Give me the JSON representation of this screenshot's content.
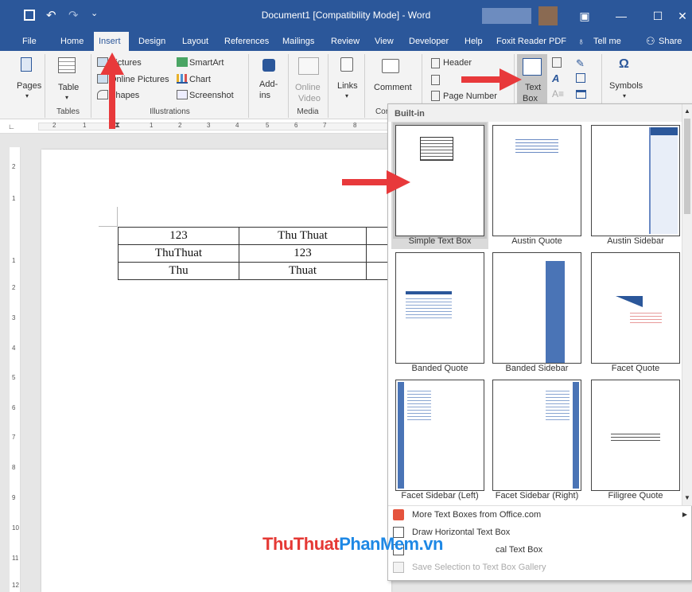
{
  "titlebar": {
    "title": "Document1 [Compatibility Mode] - Word"
  },
  "tabs": [
    "File",
    "Home",
    "Insert",
    "Design",
    "Layout",
    "References",
    "Mailings",
    "Review",
    "View",
    "Developer",
    "Help",
    "Foxit Reader PDF",
    "Tell me",
    "Share"
  ],
  "ribbon": {
    "pages": "Pages",
    "table": "Table",
    "pictures": "Pictures",
    "online_pictures": "Online Pictures",
    "shapes": "Shapes",
    "smartart": "SmartArt",
    "chart": "Chart",
    "screenshot": "Screenshot",
    "addins_1": "Add-",
    "addins_2": "ins",
    "online_video_1": "Online",
    "online_video_2": "Video",
    "links": "Links",
    "comment": "Comment",
    "header": "Header",
    "page_number": "Page Number",
    "textbox_1": "Text",
    "textbox_2": "Box",
    "symbols": "Symbols",
    "groups": {
      "tables": "Tables",
      "illustrations": "Illustrations",
      "media": "Media",
      "comments": "Cor"
    }
  },
  "ruler_marks": [
    "2",
    "1",
    "1",
    "2",
    "3",
    "4",
    "5",
    "6",
    "7",
    "8"
  ],
  "vruler_marks": [
    "2",
    "1",
    "1",
    "2",
    "3",
    "4",
    "5",
    "6",
    "7",
    "8",
    "9",
    "10",
    "11",
    "12"
  ],
  "table": {
    "rows": [
      [
        "123",
        "Thu Thuat",
        ""
      ],
      [
        "ThuThuat",
        "123",
        ""
      ],
      [
        "Thu",
        "Thuat",
        ""
      ]
    ]
  },
  "dropdown": {
    "header": "Built-in",
    "items": [
      "Simple Text Box",
      "Austin Quote",
      "Austin Sidebar",
      "Banded Quote",
      "Banded Sidebar",
      "Facet Quote",
      "Facet Sidebar (Left)",
      "Facet Sidebar (Right)",
      "Filigree Quote"
    ],
    "menu": [
      {
        "label": "More Text Boxes from Office.com",
        "mnemonic": "M",
        "rest": "ore Text Boxes from Office.com",
        "disabled": false
      },
      {
        "label": "Draw Horizontal Text Box",
        "mnemonic": "",
        "rest": "Draw Horizontal Text Box",
        "disabled": false
      },
      {
        "label": "Draw Vertical Text Box",
        "mnemonic": "",
        "rest": "cal Text Box",
        "disabled": false
      },
      {
        "label": "Save Selection to Text Box Gallery",
        "mnemonic": "",
        "rest": "Save Selection to Text Box Gallery",
        "disabled": true
      }
    ]
  },
  "watermark": {
    "part1": "ThuThuat",
    "part2": "PhanMem",
    "part3": ".vn"
  },
  "colors": {
    "brand": "#2b579a",
    "arrow": "#e8393b",
    "wm_blue": "#1e88e5",
    "wm_red": "#e53935"
  }
}
